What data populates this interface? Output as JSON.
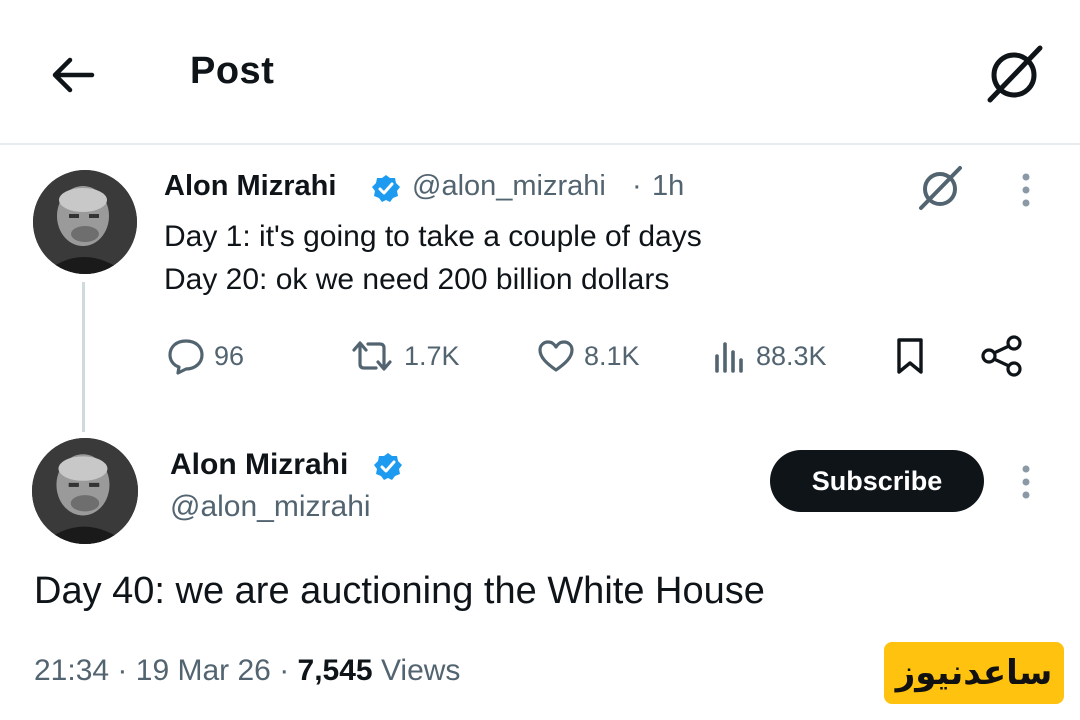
{
  "header": {
    "title": "Post"
  },
  "parent_tweet": {
    "name": "Alon Mizrahi",
    "handle": "@alon_mizrahi",
    "separator": "·",
    "time": "1h",
    "lines": [
      "Day 1: it's going to take a couple of days",
      "Day 20: ok we need 200 billion dollars"
    ],
    "actions": {
      "replies": "96",
      "retweets": "1.7K",
      "likes": "8.1K",
      "views": "88.3K"
    }
  },
  "main_tweet": {
    "name": "Alon Mizrahi",
    "handle": "@alon_mizrahi",
    "subscribe_label": "Subscribe",
    "text": "Day 40: we are auctioning the White House",
    "time": "21:34",
    "date": "19 Mar 26",
    "sep": "·",
    "views_count": "7,545",
    "views_label": "Views"
  },
  "watermark": {
    "text": "ساعدنیوز"
  },
  "icons": {
    "back": "arrow-left-icon",
    "grok": "grok-icon",
    "verified": "verified-badge-icon",
    "more": "more-vertical-icon",
    "reply": "reply-icon",
    "retweet": "retweet-icon",
    "like": "heart-icon",
    "views": "views-icon",
    "bookmark": "bookmark-icon",
    "share": "share-icon"
  },
  "colors": {
    "text": "#0f1419",
    "secondary": "#536471",
    "verified": "#1d9bf0",
    "button_bg": "#0f1419",
    "watermark_bg": "#ffc20e"
  }
}
